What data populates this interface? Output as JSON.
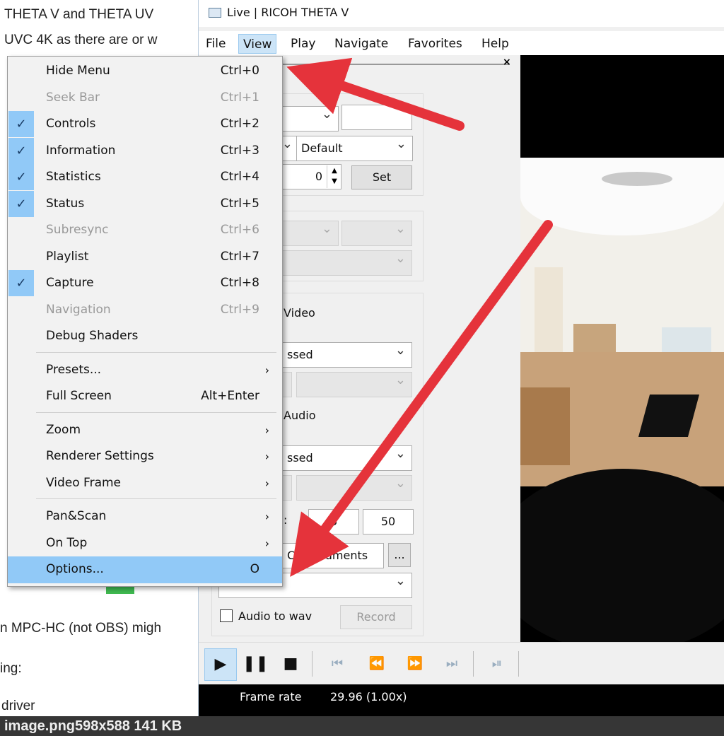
{
  "background_page": {
    "lines": [
      "THETA V and THETA UV",
      "UVC 4K as there are or w",
      "n MPC-HC (not OBS) migh",
      "ing:",
      "driver"
    ],
    "caption": "image.png598x588 141 KB"
  },
  "window": {
    "title": "Live | RICOH THETA V",
    "menubar": [
      "File",
      "View",
      "Play",
      "Navigate",
      "Favorites",
      "Help"
    ],
    "active_menu": "View"
  },
  "view_menu": {
    "items": [
      {
        "label": "Hide Menu",
        "shortcut": "Ctrl+0",
        "checked": false,
        "disabled": false
      },
      {
        "label": "Seek Bar",
        "shortcut": "Ctrl+1",
        "checked": false,
        "disabled": true
      },
      {
        "label": "Controls",
        "shortcut": "Ctrl+2",
        "checked": true,
        "disabled": false
      },
      {
        "label": "Information",
        "shortcut": "Ctrl+3",
        "checked": true,
        "disabled": false
      },
      {
        "label": "Statistics",
        "shortcut": "Ctrl+4",
        "checked": true,
        "disabled": false
      },
      {
        "label": "Status",
        "shortcut": "Ctrl+5",
        "checked": true,
        "disabled": false
      },
      {
        "label": "Subresync",
        "shortcut": "Ctrl+6",
        "checked": false,
        "disabled": true
      },
      {
        "label": "Playlist",
        "shortcut": "Ctrl+7",
        "checked": false,
        "disabled": false
      },
      {
        "label": "Capture",
        "shortcut": "Ctrl+8",
        "checked": true,
        "disabled": false
      },
      {
        "label": "Navigation",
        "shortcut": "Ctrl+9",
        "checked": false,
        "disabled": true
      },
      {
        "label": "Debug Shaders",
        "shortcut": "",
        "checked": false,
        "disabled": false
      },
      {
        "label": "Presets...",
        "shortcut": "",
        "submenu": true
      },
      {
        "label": "Full Screen",
        "shortcut": "Alt+Enter"
      },
      {
        "label": "Zoom",
        "shortcut": "",
        "submenu": true
      },
      {
        "label": "Renderer Settings",
        "shortcut": "",
        "submenu": true
      },
      {
        "label": "Video Frame",
        "shortcut": "",
        "submenu": true
      },
      {
        "label": "Pan&Scan",
        "shortcut": "",
        "submenu": true
      },
      {
        "label": "On Top",
        "shortcut": "",
        "submenu": true
      },
      {
        "label": "Options...",
        "shortcut": "O",
        "selected": true
      }
    ],
    "check_glyph": "✓",
    "submenu_glyph": "›"
  },
  "capture_panel": {
    "format_default": "Default",
    "spin_value": "0",
    "set_label": "Set",
    "video_label": "Video",
    "video_codec": "ssed",
    "audio_label": "Audio",
    "audio_codec": "ssed",
    "buffer_label": ":",
    "buffer_video": "o",
    "buffer_audio": "50",
    "output_path": "Cr   Documents",
    "browse_label": "...",
    "audio_to_wav": "Audio to wav",
    "record_label": "Record"
  },
  "transport": {
    "icons": [
      "play-icon",
      "pause-icon",
      "stop-icon",
      "skip-back-icon",
      "rewind-icon",
      "fast-forward-icon",
      "skip-forward-icon",
      "frame-step-icon"
    ]
  },
  "status": {
    "frame_rate_label": "Frame rate",
    "frame_rate_value": "29.96 (1.00x)"
  },
  "colors": {
    "arrow": "#e5333b",
    "highlight": "#91c9f7",
    "active_menu": "#cce4f7"
  }
}
